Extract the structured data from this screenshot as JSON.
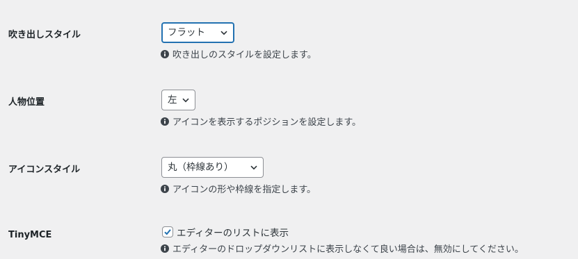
{
  "fields": [
    {
      "label": "吹き出しスタイル",
      "value": "フラット",
      "description": "吹き出しのスタイルを設定します。"
    },
    {
      "label": "人物位置",
      "value": "左",
      "description": "アイコンを表示するポジションを設定します。"
    },
    {
      "label": "アイコンスタイル",
      "value": "丸（枠線あり）",
      "description": "アイコンの形や枠線を指定します。"
    },
    {
      "label": "TinyMCE",
      "checkbox_label": "エディターのリストに表示",
      "checked": true,
      "description": "エディターのドロップダウンリストに表示しなくて良い場合は、無効にしてください。"
    }
  ],
  "colors": {
    "background": "#f0f0f1",
    "focus_border": "#2271b1",
    "border": "#8c8f94",
    "text": "#1d2327"
  },
  "icons": {
    "select_arrow": "chevron-down-icon",
    "description": "info-icon",
    "checkbox": "checkmark-icon"
  }
}
